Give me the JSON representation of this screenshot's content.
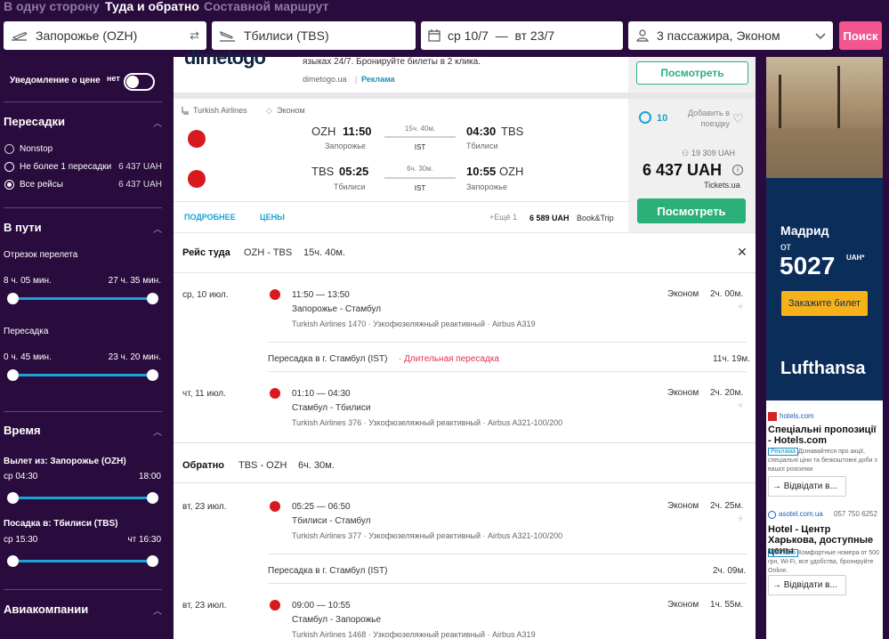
{
  "trip_tabs": [
    "В одну сторону",
    "Туда и обратно",
    "Составной маршрут"
  ],
  "search": {
    "from": "Запорожье (OZH)",
    "to": "Тбилиси (TBS)",
    "dates": "ср 10/7  —  вт 23/7",
    "passengers": "3 пассажира, Эконом",
    "button": "Поиск"
  },
  "sidebar": {
    "price_alert_label": "Уведомление о цене",
    "price_alert_toggle": "нет",
    "stops_title": "Пересадки",
    "stops": [
      {
        "label": "Nonstop",
        "price": ""
      },
      {
        "label": "Не более 1 пересадки",
        "price": "6 437 UAH"
      },
      {
        "label": "Все рейсы",
        "price": "6 437 UAH"
      }
    ],
    "travel_title": "В пути",
    "segment_label": "Отрезок перелета",
    "segment_min": "8 ч. 05 мин.",
    "segment_max": "27 ч. 35 мин.",
    "layover_label": "Пересадка",
    "layover_min": "0 ч. 45 мин.",
    "layover_max": "23 ч. 20 мин.",
    "time_title": "Время",
    "depart_label": "Вылет из: Запорожье (OZH)",
    "depart_min": "ср 04:30",
    "depart_max": "18:00",
    "arrive_label": "Посадка в: Тбилиси (TBS)",
    "arrive_min": "ср 15:30",
    "arrive_max": "чт 16:30",
    "airlines_title": "Авиакомпании"
  },
  "ad_top": {
    "logo": "dimetogo",
    "text": "языках 24/7. Бронируйте билеты в 2 клика.",
    "domain": "dimetogo.ua",
    "ad_label": "Реклама",
    "button": "Посмотреть"
  },
  "result": {
    "airline": "Turkish Airlines",
    "cabin": "Эконом",
    "outbound": {
      "from_code": "OZH",
      "dep": "11:50",
      "from_city": "Запорожье",
      "duration": "15ч. 40м.",
      "via": "IST",
      "arr": "04:30",
      "to_code": "TBS",
      "to_city": "Тбилиси"
    },
    "inbound": {
      "from_code": "TBS",
      "dep": "05:25",
      "from_city": "Тбилиси",
      "duration": "6ч. 30м.",
      "via": "IST",
      "arr": "10:55",
      "to_code": "OZH",
      "to_city": "Запорожье"
    },
    "score": "10",
    "add_to_trip": "Добавить в поездку",
    "old_price": "19 309 UAH",
    "price": "6 437 UAH",
    "provider": "Tickets.ua",
    "button": "Посмотреть",
    "link_details": "ПОДРОБНЕЕ",
    "link_prices": "ЦЕНЫ",
    "more": "+Ещё 1",
    "alt_price": "6 589 UAH",
    "alt_provider": "Book&Trip"
  },
  "details": {
    "outbound_title": "Рейс туда",
    "outbound_route": "OZH - TBS",
    "outbound_total": "15ч. 40м.",
    "legs_out": [
      {
        "date": "ср, 10 июл.",
        "times": "11:50 — 13:50",
        "route": "Запорожье - Стамбул",
        "info": "Turkish Airlines 1470 · Узкофюзеляжный реактивный · Airbus A319",
        "cabin": "Эконом",
        "dur": "2ч. 00м."
      },
      {
        "date": "чт, 11 июл.",
        "times": "01:10 — 04:30",
        "route": "Стамбул - Тбилиси",
        "info": "Turkish Airlines 376 · Узкофюзеляжный реактивный · Airbus A321-100/200",
        "cabin": "Эконом",
        "dur": "2ч. 20м."
      }
    ],
    "layover_out": "Пересадка в г. Стамбул (IST)",
    "layover_out_warn": "· Длительная пересадка",
    "layover_out_dur": "11ч. 19м.",
    "inbound_title": "Обратно",
    "inbound_route": "TBS - OZH",
    "inbound_total": "6ч. 30м.",
    "legs_in": [
      {
        "date": "вт, 23 июл.",
        "times": "05:25 — 06:50",
        "route": "Тбилиси - Стамбул",
        "info": "Turkish Airlines 377 · Узкофюзеляжный реактивный · Airbus A321-100/200",
        "cabin": "Эконом",
        "dur": "2ч. 25м."
      },
      {
        "date": "вт, 23 июл.",
        "times": "09:00 — 10:55",
        "route": "Стамбул - Запорожье",
        "info": "Turkish Airlines 1468 · Узкофюзеляжный реактивный · Airbus A319",
        "cabin": "Эконом",
        "dur": "1ч. 55м."
      }
    ],
    "layover_in": "Пересадка в г. Стамбул (IST)",
    "layover_in_dur": "2ч. 09м."
  },
  "right_ads": {
    "lh_city": "Мадрид",
    "lh_from": "от",
    "lh_price": "5027",
    "lh_currency": "UAH*",
    "lh_button": "Закажите билет",
    "lh_brand": "Lufthansa",
    "hotels_domain": "hotels.com",
    "hotels_title": "Спеціальні пропозиції - Hotels.com",
    "hotels_tag": "Реклама",
    "hotels_text": "Дізнавайтеся про акції, спеціальні ціни та безкоштовні доби з вашої розсилки",
    "hotels_btn": "Відвідати в...",
    "asotel_domain": "asotel.com.ua",
    "asotel_phone": "057 750 6252",
    "asotel_title": "Hotel - Центр Харькова, доступные цены",
    "asotel_tag": "Реклама",
    "asotel_text": "Комфортные номера от 500 грн, Wi-Fi, все удобства, бронируйте Online.",
    "asotel_btn": "Відвідати в..."
  },
  "colors": {
    "bg": "#2a0b3d",
    "accent_pink": "#f3558e",
    "green": "#2bb07a",
    "blue": "#1aa3d6",
    "red_warn": "#e0344a"
  }
}
